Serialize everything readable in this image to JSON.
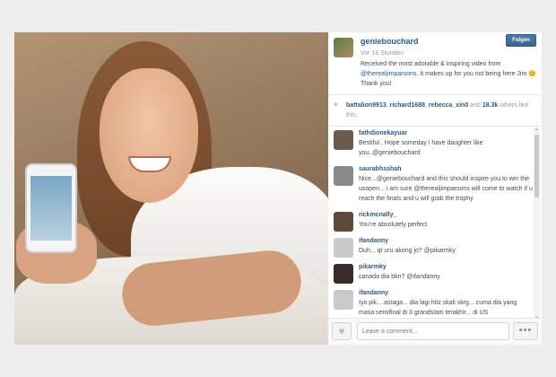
{
  "post": {
    "image_alt": "Selfie of a smiling woman in a white tank top lying down, holding an iPhone showing a photo",
    "author": {
      "username": "geniebouchard",
      "avatar_icon": "user-avatar"
    },
    "follow_label": "Folgen",
    "time_ago": "Vor 16 Stunden",
    "caption_prefix": "Received the most adorable & inspiring video from ",
    "caption_mention": "@therealjimparsons",
    "caption_suffix": ". It makes up for you not being here Jim 😊 Thank you!"
  },
  "likes": {
    "icon": "heart-icon",
    "user1": "battalion9913",
    "user2": "richard1688",
    "user3": "rebecca_xin0",
    "and_text": "and",
    "count": "18.3k",
    "suffix": "others like this."
  },
  "comments": [
    {
      "user": "fathdionekayuar",
      "text": "Bestiful.. Hope someday i have daughter like you..@geniebouchard",
      "avatar_color": "#6a5b4e"
    },
    {
      "user": "saurabhsshah",
      "text": "Nice...@geniebouchard and this should inspire you to win the usopen... i am sure @therealjimparsons will come to watch if u reach the finals and u will grab the trophy",
      "avatar_color": "#8a8a8a"
    },
    {
      "user": "rickmcnally_",
      "text": "You're absolutely perfect",
      "avatar_color": "#5c4a3d"
    },
    {
      "user": "ifandanny",
      "text": "Duh... qt uru akong jo? @pikarmky",
      "avatar_color": "#c9c9c9"
    },
    {
      "user": "pikarmky",
      "text": "canada dia bkn? @ifandanny",
      "avatar_color": "#3a2a2a"
    },
    {
      "user": "ifandanny",
      "text": "Iyo pik... astaga... dia lagi hitz skali skrg... cuma dia yang masa semifinal di 3 grandslam terakhir... di US",
      "avatar_color": "#c9c9c9"
    }
  ],
  "footer": {
    "like_icon": "heart-icon",
    "comment_placeholder": "Leave a comment...",
    "more_icon": "ellipsis-icon",
    "more_label": "•••"
  },
  "colors": {
    "link": "#2d5a80",
    "follow_button": "#3a6490"
  }
}
